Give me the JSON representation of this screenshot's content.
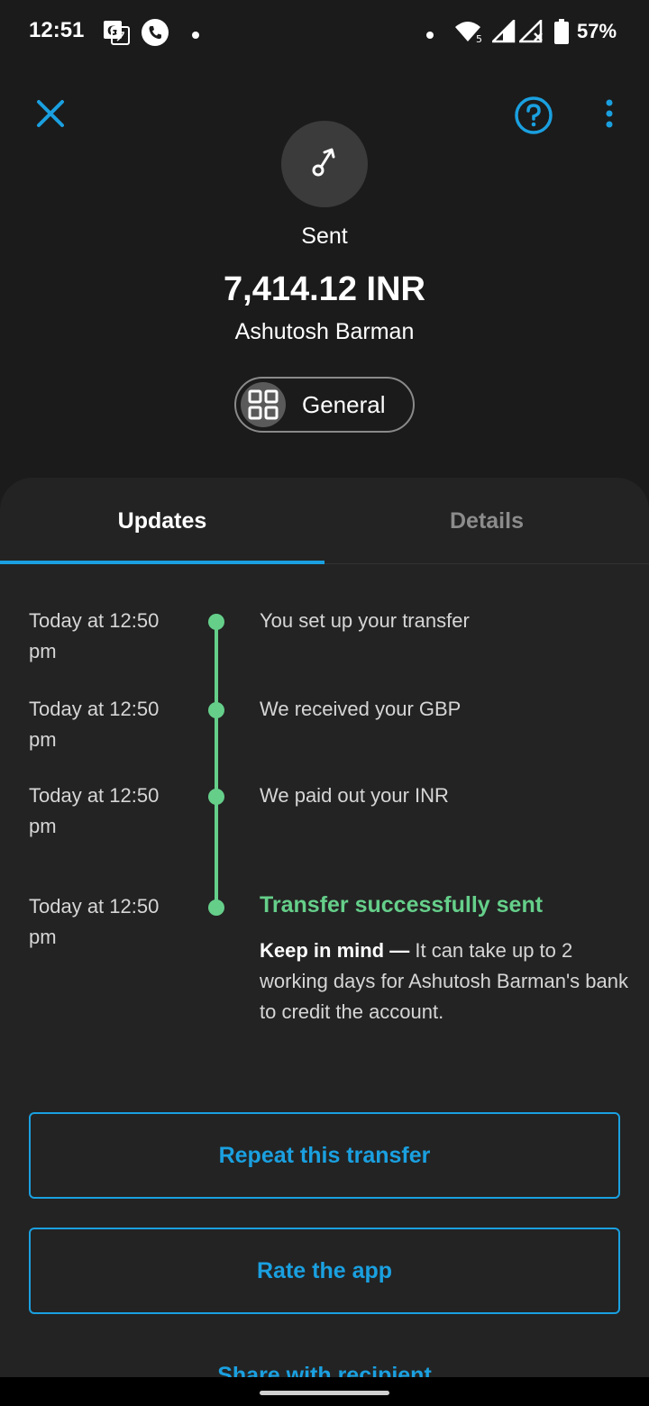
{
  "status_bar": {
    "time": "12:51",
    "battery": "57%",
    "icons": [
      "translate-icon",
      "phone-call-icon",
      "dot-icon",
      "dot-icon",
      "wifi-icon",
      "signal-icon",
      "signal-no-data-icon",
      "battery-icon"
    ]
  },
  "header": {
    "close_icon": "close-icon",
    "help_icon": "help-icon",
    "more_icon": "more-vertical-icon"
  },
  "summary": {
    "status_label": "Sent",
    "amount": "7,414.12 INR",
    "recipient": "Ashutosh Barman",
    "category": "General"
  },
  "tabs": [
    {
      "label": "Updates",
      "active": true
    },
    {
      "label": "Details",
      "active": false
    }
  ],
  "timeline": [
    {
      "time": "Today at 12:50 pm",
      "text": "You set up your transfer"
    },
    {
      "time": "Today at 12:50 pm",
      "text": "We received your GBP"
    },
    {
      "time": "Today at 12:50 pm",
      "text": "We paid out your INR"
    },
    {
      "time": "Today at 12:50 pm",
      "text": "Transfer successfully sent"
    }
  ],
  "note": {
    "bold": "Keep in mind —",
    "text": " It can take up to 2 working days for Ashutosh Barman's bank to credit the account."
  },
  "buttons": {
    "repeat": "Repeat this transfer",
    "rate": "Rate the app",
    "share": "Share with recipient"
  },
  "colors": {
    "background": "#1b1b1b",
    "card": "#232323",
    "accent_blue": "#1aa0e0",
    "success_green": "#65cf8a"
  }
}
